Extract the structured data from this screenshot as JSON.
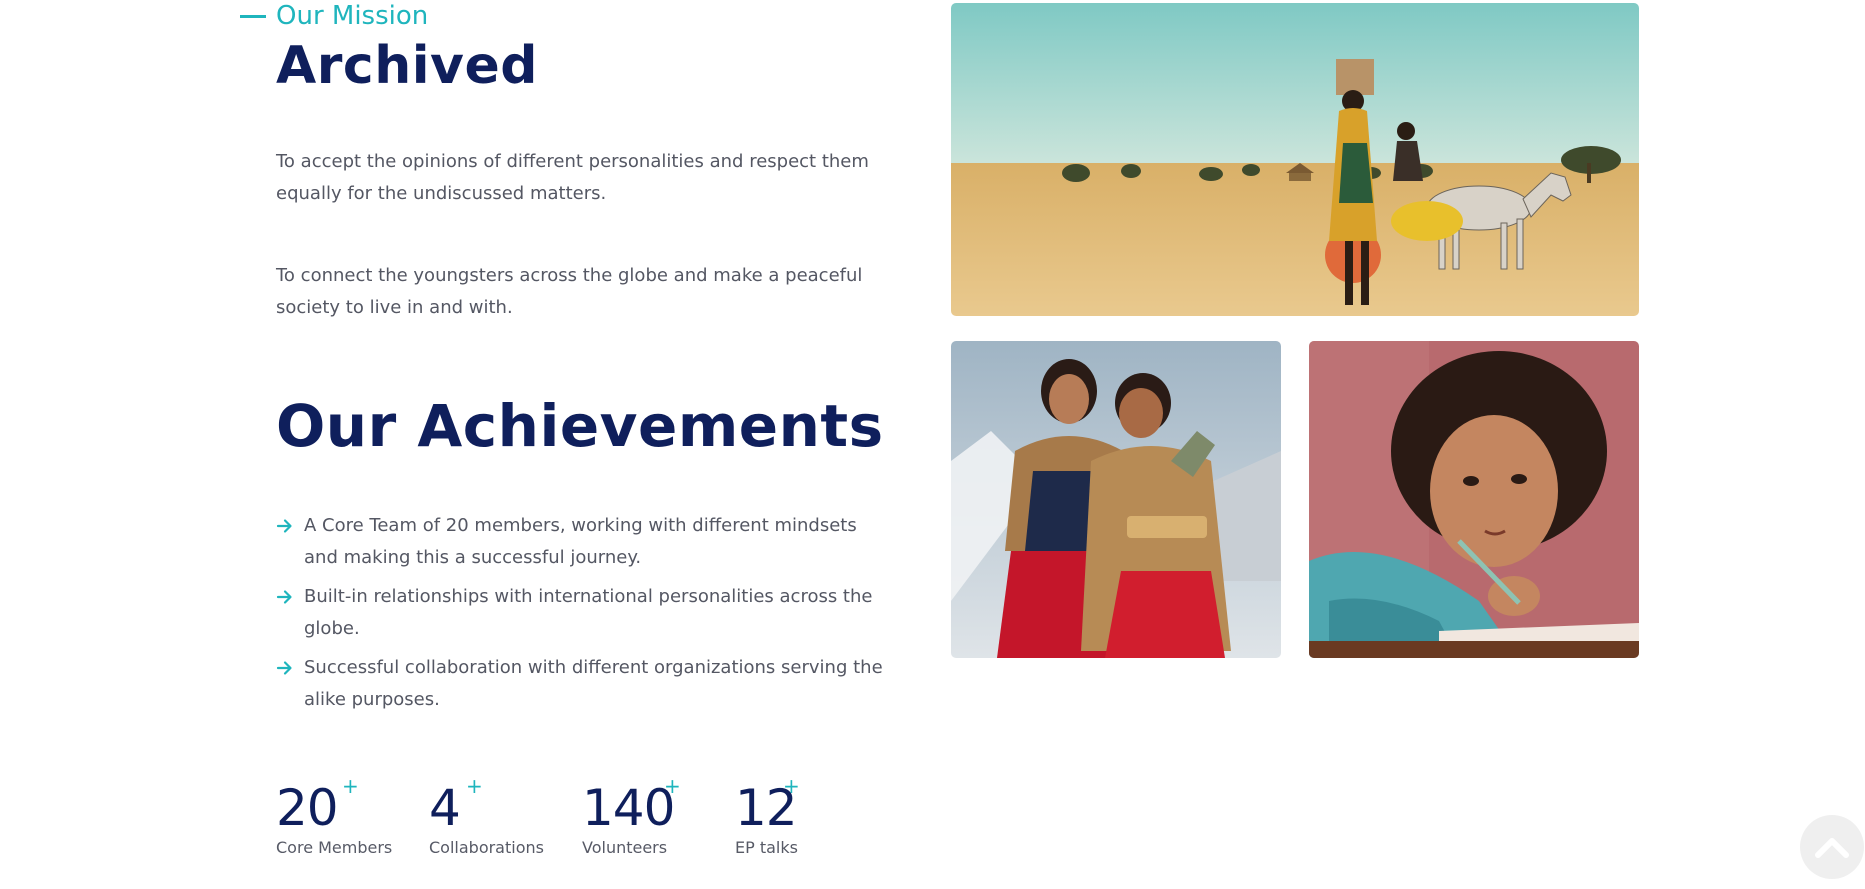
{
  "mission": {
    "eyebrow": "Our Mission",
    "title": "Archived",
    "paragraphs": [
      "To accept the opinions of different personalities and respect them equally for the undiscussed matters.",
      "To connect the youngsters across the globe and make a peaceful society to live in and with."
    ]
  },
  "achievements": {
    "title": "Our Achievements",
    "items": [
      "A Core Team of 20 members, working with different mindsets and making this a successful journey.",
      "Built-in relationships with international personalities across the globe.",
      "Successful collaboration with different organizations serving the alike purposes."
    ]
  },
  "stats": [
    {
      "value": "20",
      "suffix": "+",
      "label": "Core Members"
    },
    {
      "value": "4",
      "suffix": "+",
      "label": "Collaborations"
    },
    {
      "value": "140",
      "suffix": "+",
      "label": "Volunteers"
    },
    {
      "value": "12",
      "suffix": "+",
      "label": "EP talks"
    }
  ],
  "images": [
    {
      "name": "woman-with-donkey-desert-photo"
    },
    {
      "name": "two-smiling-women-photo"
    },
    {
      "name": "girl-writing-photo"
    }
  ],
  "colors": {
    "accent": "#1fb5bd",
    "heading": "#0f1f5c",
    "body": "#545763"
  },
  "icons": {
    "list_bullet": "arrow-right-icon",
    "scroll": "chevron-up-icon"
  }
}
